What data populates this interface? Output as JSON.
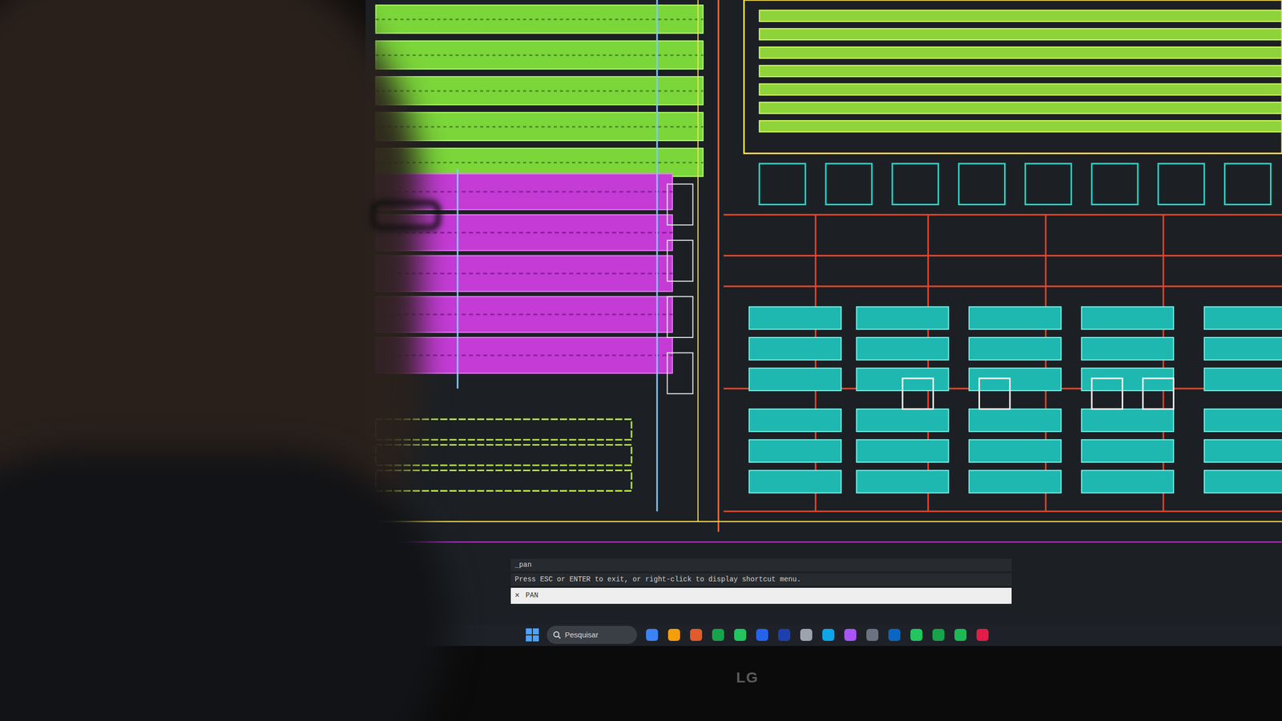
{
  "monitor": {
    "brand": "LG"
  },
  "cad": {
    "command_history": [
      "_pan",
      "Press ESC or ENTER to exit, or right-click to display shortcut menu."
    ],
    "command_input": "PAN",
    "close": "×"
  },
  "taskbar": {
    "search_placeholder": "Pesquisar"
  }
}
